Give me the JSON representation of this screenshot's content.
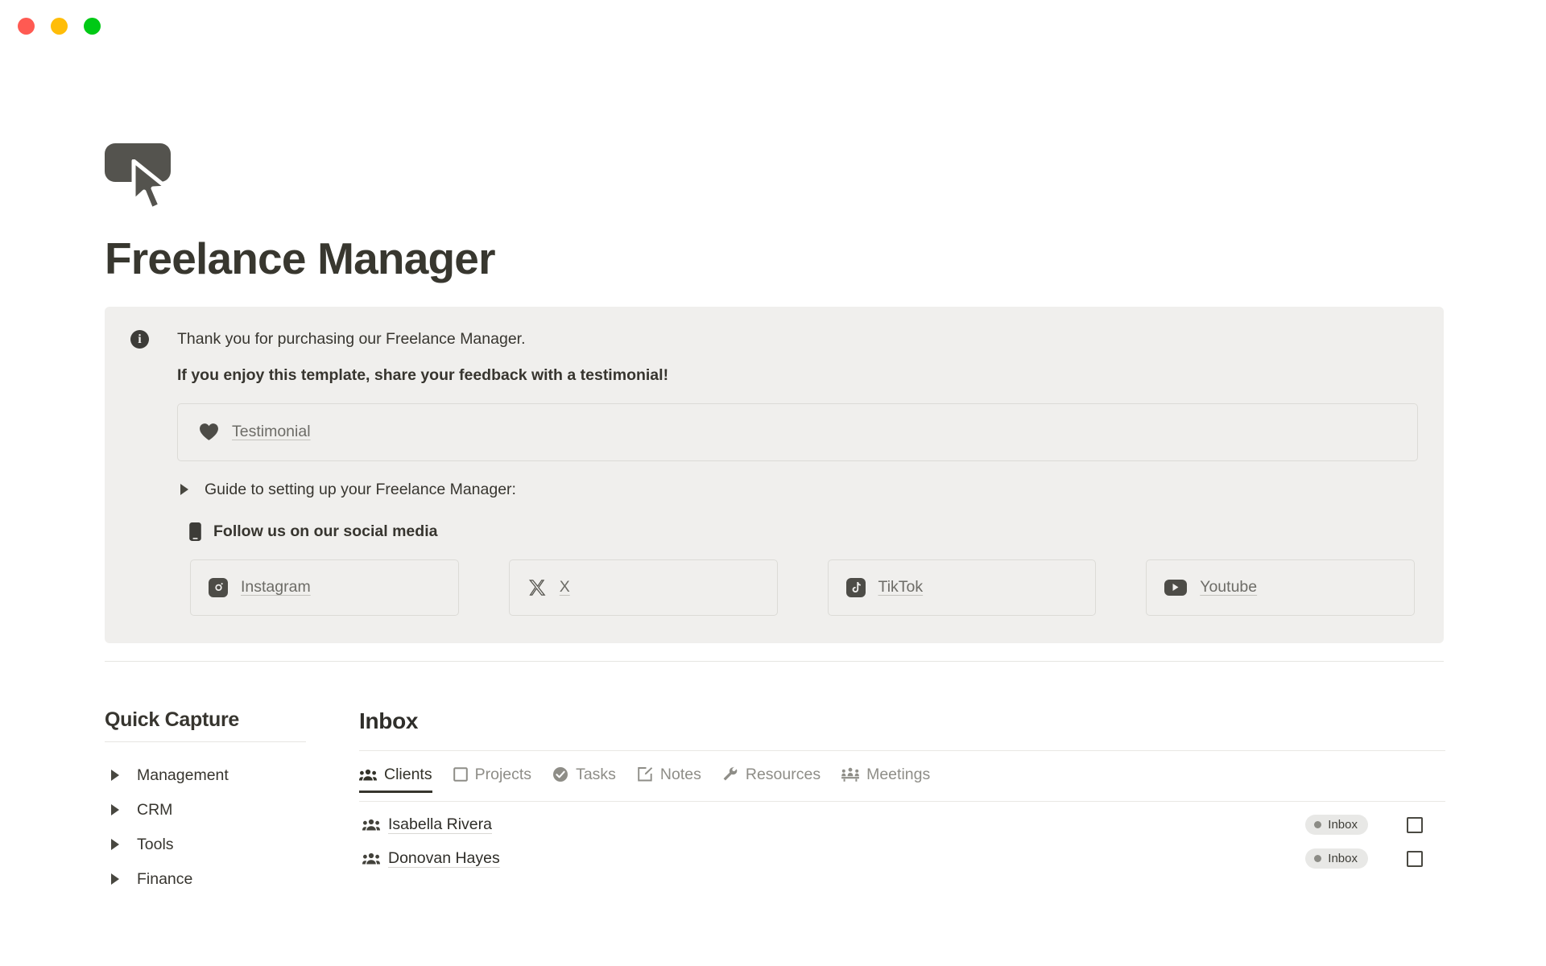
{
  "window": {
    "traffic_lights": [
      {
        "name": "close",
        "color": "#ff5a52"
      },
      {
        "name": "minimize",
        "color": "#ffbd08"
      },
      {
        "name": "maximize",
        "color": "#00c915"
      }
    ]
  },
  "page": {
    "icon": "cursor-click-icon",
    "title": "Freelance Manager"
  },
  "callout": {
    "icon": "info-icon",
    "info_glyph": "i",
    "line1": "Thank you for purchasing our Freelance Manager.",
    "line2": "If you enjoy this template, share your feedback with a testimonial!",
    "testimonial": {
      "icon": "heart-icon",
      "label": "Testimonial"
    },
    "toggle": {
      "icon": "triangle-right-icon",
      "label": "Guide to setting up your Freelance Manager:"
    },
    "social_header": {
      "icon": "mobile-phone-icon",
      "label": "Follow us on our social media"
    },
    "social_links": [
      {
        "icon": "instagram-icon",
        "label": "Instagram"
      },
      {
        "icon": "x-twitter-icon",
        "label": "X"
      },
      {
        "icon": "tiktok-icon",
        "label": "TikTok"
      },
      {
        "icon": "youtube-icon",
        "label": "Youtube"
      }
    ]
  },
  "quick_capture": {
    "title": "Quick Capture",
    "items": [
      {
        "icon": "triangle-right-icon",
        "label": "Management"
      },
      {
        "icon": "triangle-right-icon",
        "label": "CRM"
      },
      {
        "icon": "triangle-right-icon",
        "label": "Tools"
      },
      {
        "icon": "triangle-right-icon",
        "label": "Finance"
      }
    ]
  },
  "inbox": {
    "title": "Inbox",
    "tabs": [
      {
        "label": "Clients",
        "icon": "people-group-icon",
        "active": true
      },
      {
        "label": "Projects",
        "icon": "square-outline-icon",
        "active": false
      },
      {
        "label": "Tasks",
        "icon": "check-circle-icon",
        "active": false
      },
      {
        "label": "Notes",
        "icon": "note-edit-icon",
        "active": false
      },
      {
        "label": "Resources",
        "icon": "wrench-icon",
        "active": false
      },
      {
        "label": "Meetings",
        "icon": "meeting-people-icon",
        "active": false
      }
    ],
    "rows": [
      {
        "icon": "people-group-icon",
        "name": "Isabella Rivera",
        "badge": "Inbox",
        "checked": false
      },
      {
        "icon": "people-group-icon",
        "name": "Donovan Hayes",
        "badge": "Inbox",
        "checked": false
      }
    ]
  },
  "colors": {
    "callout_bg": "#f0efed",
    "text_primary": "#37352f",
    "text_muted": "#8e8d87",
    "icon_dark": "#4d4c47",
    "border": "#dcdbd7"
  }
}
